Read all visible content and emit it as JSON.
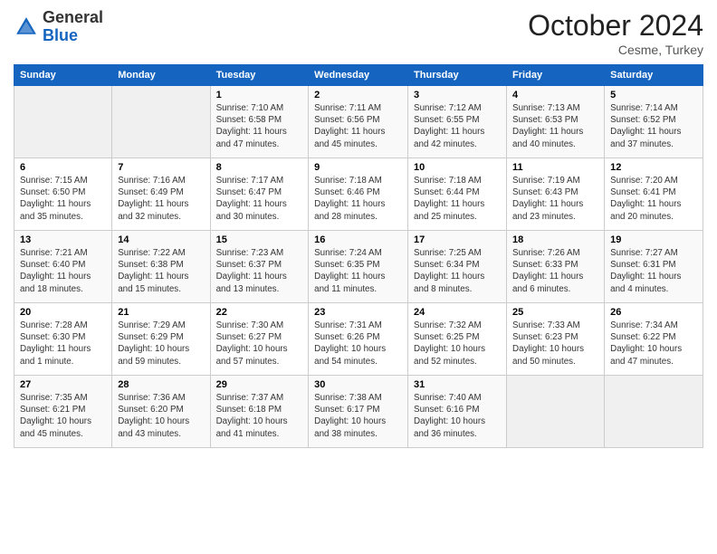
{
  "header": {
    "logo_line1": "General",
    "logo_line2": "Blue",
    "month": "October 2024",
    "location": "Cesme, Turkey"
  },
  "weekdays": [
    "Sunday",
    "Monday",
    "Tuesday",
    "Wednesday",
    "Thursday",
    "Friday",
    "Saturday"
  ],
  "weeks": [
    [
      {
        "day": "",
        "info": ""
      },
      {
        "day": "",
        "info": ""
      },
      {
        "day": "1",
        "info": "Sunrise: 7:10 AM\nSunset: 6:58 PM\nDaylight: 11 hours and 47 minutes."
      },
      {
        "day": "2",
        "info": "Sunrise: 7:11 AM\nSunset: 6:56 PM\nDaylight: 11 hours and 45 minutes."
      },
      {
        "day": "3",
        "info": "Sunrise: 7:12 AM\nSunset: 6:55 PM\nDaylight: 11 hours and 42 minutes."
      },
      {
        "day": "4",
        "info": "Sunrise: 7:13 AM\nSunset: 6:53 PM\nDaylight: 11 hours and 40 minutes."
      },
      {
        "day": "5",
        "info": "Sunrise: 7:14 AM\nSunset: 6:52 PM\nDaylight: 11 hours and 37 minutes."
      }
    ],
    [
      {
        "day": "6",
        "info": "Sunrise: 7:15 AM\nSunset: 6:50 PM\nDaylight: 11 hours and 35 minutes."
      },
      {
        "day": "7",
        "info": "Sunrise: 7:16 AM\nSunset: 6:49 PM\nDaylight: 11 hours and 32 minutes."
      },
      {
        "day": "8",
        "info": "Sunrise: 7:17 AM\nSunset: 6:47 PM\nDaylight: 11 hours and 30 minutes."
      },
      {
        "day": "9",
        "info": "Sunrise: 7:18 AM\nSunset: 6:46 PM\nDaylight: 11 hours and 28 minutes."
      },
      {
        "day": "10",
        "info": "Sunrise: 7:18 AM\nSunset: 6:44 PM\nDaylight: 11 hours and 25 minutes."
      },
      {
        "day": "11",
        "info": "Sunrise: 7:19 AM\nSunset: 6:43 PM\nDaylight: 11 hours and 23 minutes."
      },
      {
        "day": "12",
        "info": "Sunrise: 7:20 AM\nSunset: 6:41 PM\nDaylight: 11 hours and 20 minutes."
      }
    ],
    [
      {
        "day": "13",
        "info": "Sunrise: 7:21 AM\nSunset: 6:40 PM\nDaylight: 11 hours and 18 minutes."
      },
      {
        "day": "14",
        "info": "Sunrise: 7:22 AM\nSunset: 6:38 PM\nDaylight: 11 hours and 15 minutes."
      },
      {
        "day": "15",
        "info": "Sunrise: 7:23 AM\nSunset: 6:37 PM\nDaylight: 11 hours and 13 minutes."
      },
      {
        "day": "16",
        "info": "Sunrise: 7:24 AM\nSunset: 6:35 PM\nDaylight: 11 hours and 11 minutes."
      },
      {
        "day": "17",
        "info": "Sunrise: 7:25 AM\nSunset: 6:34 PM\nDaylight: 11 hours and 8 minutes."
      },
      {
        "day": "18",
        "info": "Sunrise: 7:26 AM\nSunset: 6:33 PM\nDaylight: 11 hours and 6 minutes."
      },
      {
        "day": "19",
        "info": "Sunrise: 7:27 AM\nSunset: 6:31 PM\nDaylight: 11 hours and 4 minutes."
      }
    ],
    [
      {
        "day": "20",
        "info": "Sunrise: 7:28 AM\nSunset: 6:30 PM\nDaylight: 11 hours and 1 minute."
      },
      {
        "day": "21",
        "info": "Sunrise: 7:29 AM\nSunset: 6:29 PM\nDaylight: 10 hours and 59 minutes."
      },
      {
        "day": "22",
        "info": "Sunrise: 7:30 AM\nSunset: 6:27 PM\nDaylight: 10 hours and 57 minutes."
      },
      {
        "day": "23",
        "info": "Sunrise: 7:31 AM\nSunset: 6:26 PM\nDaylight: 10 hours and 54 minutes."
      },
      {
        "day": "24",
        "info": "Sunrise: 7:32 AM\nSunset: 6:25 PM\nDaylight: 10 hours and 52 minutes."
      },
      {
        "day": "25",
        "info": "Sunrise: 7:33 AM\nSunset: 6:23 PM\nDaylight: 10 hours and 50 minutes."
      },
      {
        "day": "26",
        "info": "Sunrise: 7:34 AM\nSunset: 6:22 PM\nDaylight: 10 hours and 47 minutes."
      }
    ],
    [
      {
        "day": "27",
        "info": "Sunrise: 7:35 AM\nSunset: 6:21 PM\nDaylight: 10 hours and 45 minutes."
      },
      {
        "day": "28",
        "info": "Sunrise: 7:36 AM\nSunset: 6:20 PM\nDaylight: 10 hours and 43 minutes."
      },
      {
        "day": "29",
        "info": "Sunrise: 7:37 AM\nSunset: 6:18 PM\nDaylight: 10 hours and 41 minutes."
      },
      {
        "day": "30",
        "info": "Sunrise: 7:38 AM\nSunset: 6:17 PM\nDaylight: 10 hours and 38 minutes."
      },
      {
        "day": "31",
        "info": "Sunrise: 7:40 AM\nSunset: 6:16 PM\nDaylight: 10 hours and 36 minutes."
      },
      {
        "day": "",
        "info": ""
      },
      {
        "day": "",
        "info": ""
      }
    ]
  ]
}
